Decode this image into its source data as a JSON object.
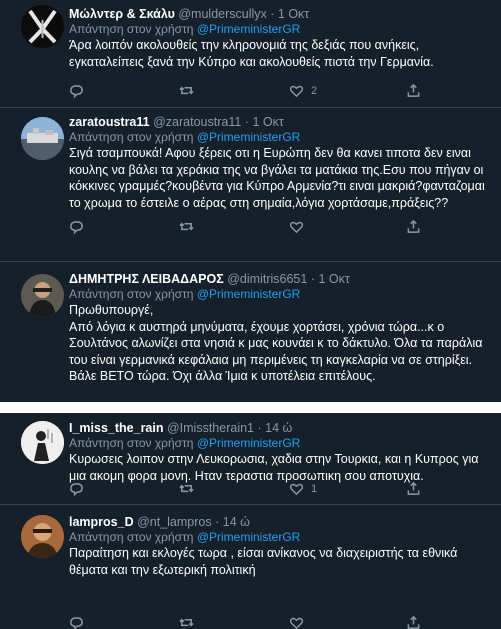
{
  "ui": {
    "reply_prefix": "Απάντηση στον χρήστη",
    "reply_mention": "@PrimeministerGR",
    "separator": "·"
  },
  "tweets": [
    {
      "name": "Μώλντερ & Σκάλυ",
      "handle": "@mulderscullyx",
      "time": "1 Οκτ",
      "text": "Άρα λοιπόν ακολουθείς την κληρονομιά της δεξιάς που ανήκεις, εγκαταλείπεις ξανά την Κύπρο και ακολουθείς πιστά την Γερμανία.",
      "likes": "2"
    },
    {
      "name": "zaratoustra11",
      "handle": "@zaratoustra11",
      "time": "1 Οκτ",
      "text": "Σιγά τσαμπουκά! Αφου ξέρεις οτι η Ευρώπη δεν θα κανει τιποτα δεν ειναι κουλης να βάλει τα χεράκια της να βγάλει τα ματάκια της.Εσυ που πήγαν οι κόκκινες γραμμές?κουβέντα για Κύπρο Αρμενία?τι ειναι μακριά?φανταζομαι το χρωμα το έστειλε ο αέρας στη σημαία,λόγια χορτάσαμε,πράξεις??"
    },
    {
      "name": "ΔΗΜΗΤΡΗΣ ΛΕΙΒΑΔΑΡΟΣ",
      "handle": "@dimitris6651",
      "time": "1 Οκτ",
      "text_lines": [
        "Πρωθυπουργέ,",
        "Από λόγια κ αυστηρά μηνύματα, έχουμε χορτάσει, χρόνια τώρα...κ ο Σουλτάνος αλωνίζει στα νησιά  κ μας κουνάει κ το δάκτυλο. Όλα τα παράλια του είναι γερμανικά κεφάλαια μη περιμένεις τη καγκελαρία να σε στηρίξει. Βάλε ΒΕΤΟ τώρα. Όχι άλλα Ίμια κ υποτέλεια επιτέλους."
      ]
    },
    {
      "name": "I_miss_the_rain",
      "handle": "@Imisstherain1",
      "time": "14 ώ",
      "text": "Κυρωσεις λοιπον στην Λευκορωσια, χαδια στην Τουρκια, και η Κυπρος για μια ακομη φορα μονη. Ηταν τεραστια προσωπικη σου αποτυχια.",
      "likes": "1"
    },
    {
      "name": "lampros_D",
      "handle": "@nt_lampros",
      "time": "14 ώ",
      "text": "Παραίτηση και εκλογές τωρα , είσαι ανίκανος να διαχειριστής τα εθνικά θέματα και την εξωτερική πολιτική"
    }
  ],
  "icons": [
    "reply-icon",
    "retweet-icon",
    "like-icon",
    "share-icon"
  ],
  "colors": {
    "background": "#15202b",
    "text": "#ffffff",
    "muted": "#8899a6",
    "link": "#1da1f2",
    "divider": "#38444d"
  }
}
